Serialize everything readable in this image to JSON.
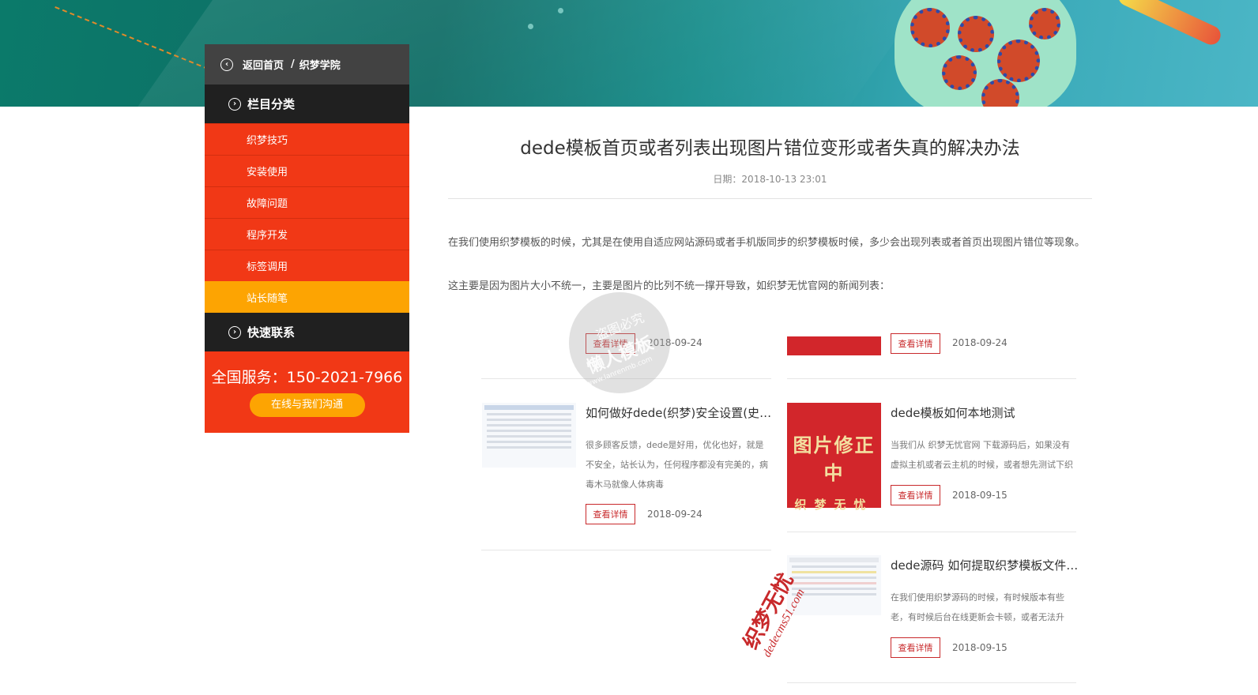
{
  "breadcrumb": {
    "home": "返回首页",
    "separator": "/",
    "current": "织梦学院"
  },
  "sidebar": {
    "category_title": "栏目分类",
    "items": [
      {
        "label": "织梦技巧"
      },
      {
        "label": "安装使用"
      },
      {
        "label": "故障问题"
      },
      {
        "label": "程序开发"
      },
      {
        "label": "标签调用"
      },
      {
        "label": "站长随笔",
        "active": true
      }
    ],
    "contact_title": "快速联系",
    "phone": "全国服务：150-2021-7966",
    "chat_button": "在线与我们沟通"
  },
  "article": {
    "title": "dede模板首页或者列表出现图片错位变形或者失真的解决办法",
    "date": "日期：2018-10-13 23:01",
    "para1": "在我们使用织梦模板的时候，尤其是在使用自适应网站源码或者手机版同步的织梦模板时候，多少会出现列表或者首页出现图片错位等现象。",
    "para2": "这主要是因为图片大小不统一，主要是图片的比列不统一撑开导致，如织梦无忧官网的新闻列表："
  },
  "news": {
    "detail_label": "查看详情",
    "top_row": [
      {
        "date": "2018-09-24"
      },
      {
        "date": "2018-09-24"
      }
    ],
    "cards": [
      {
        "title": "如何做好dede(织梦)安全设置(史上最全)",
        "desc": "很多顾客反馈，dede是好用，优化也好，就是不安全，站长认为，任何程序都没有完美的，病毒木马就像人体病毒",
        "date": "2018-09-24"
      },
      {
        "title": "dede模板如何本地测试",
        "desc": "当我们从 织梦无忧官网 下载源码后，如果没有虚拟主机或者云主机的时候，或者想先测试下织梦源码是否正确，",
        "date": "2018-09-15",
        "thumb_big": "图片修正中",
        "thumb_small": "织梦无忧"
      },
      {
        "title": "dede源码 如何提取织梦模板文件重新利用...",
        "desc": "在我们使用织梦源码的时候，有时候版本有些老，有时候后台在线更新会卡顿，或者无法升级，或者我们网站中木",
        "date": "2018-09-15"
      }
    ]
  },
  "watermarks": {
    "circle_top": "盗图必究",
    "circle_main": "懒人模板",
    "circle_url": "www.lanrenmb.com",
    "stamp_main": "织梦无忧",
    "stamp_url": "dedecms51.com"
  },
  "colors": {
    "menu_red": "#f13816",
    "menu_active": "#fda402",
    "dark": "#202020",
    "crumb": "#424242",
    "detail_red": "#c8292b"
  }
}
